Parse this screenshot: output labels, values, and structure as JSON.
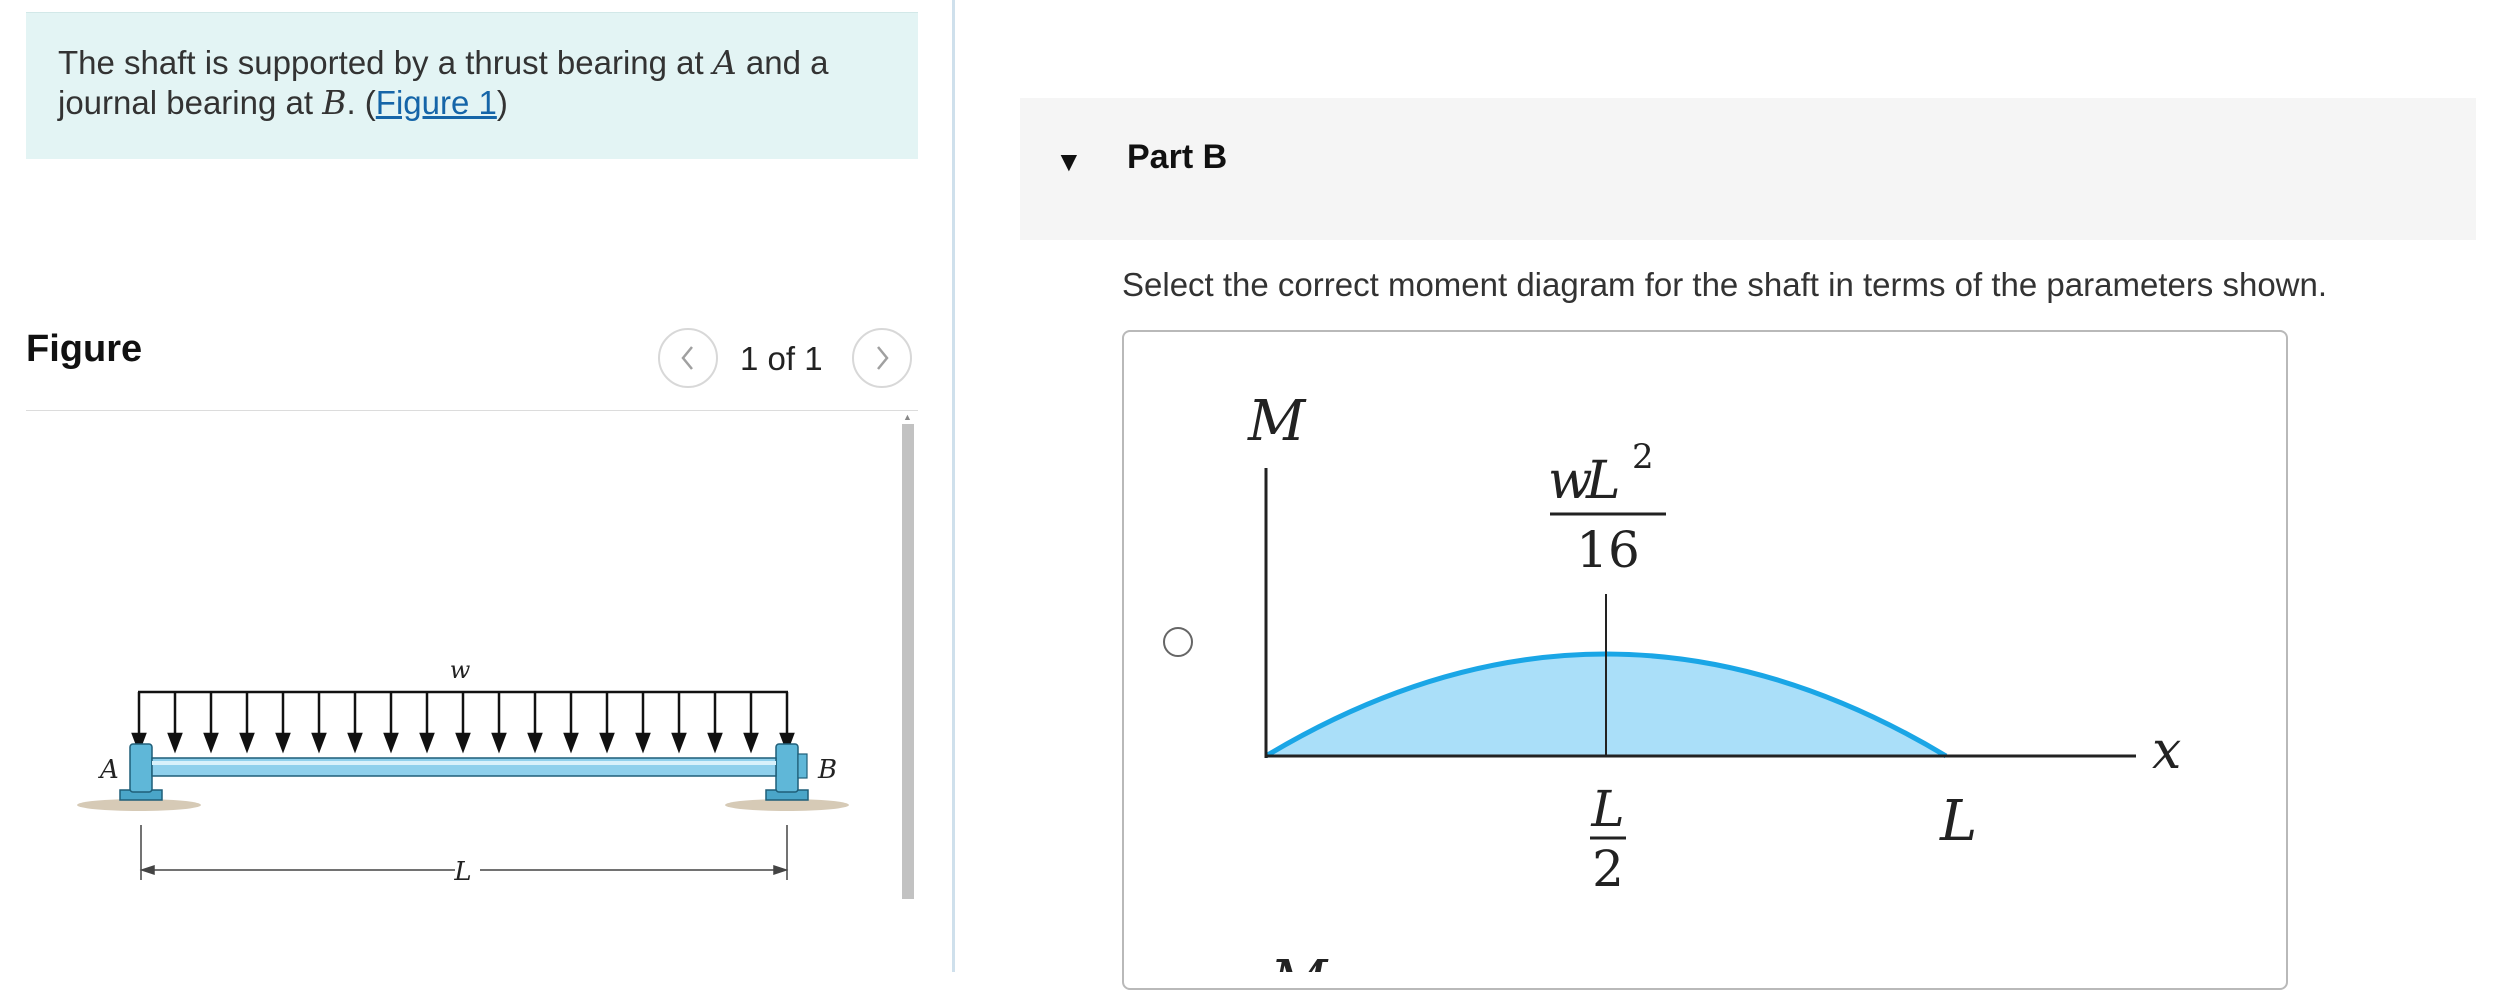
{
  "problem": {
    "text_part1": "The shaft is supported by a thrust bearing at ",
    "var_a": "A",
    "text_part2": " and a journal bearing at ",
    "var_b": "B",
    "text_part3": ". (",
    "figure_link": "Figure 1",
    "text_part4": ")"
  },
  "figure": {
    "heading": "Figure",
    "counter": "1 of 1",
    "prev_icon": "chevron-left-icon",
    "next_icon": "chevron-right-icon",
    "labels": {
      "load": "w",
      "support_a": "A",
      "support_b": "B",
      "length": "L"
    }
  },
  "part": {
    "caret_icon": "caret-down-icon",
    "title": "Part B",
    "instructions": "Select the correct moment diagram for the shaft in terms of the parameters shown."
  },
  "option_a": {
    "y_axis_label": "M",
    "x_axis_label": "x",
    "peak_numerator_w": "w",
    "peak_numerator_L": "L",
    "peak_exponent": "2",
    "peak_denominator": "16",
    "mid_label_num": "L",
    "mid_label_den": "2",
    "end_label": "L"
  },
  "colors": {
    "accent_fill": "#aadff9",
    "accent_stroke": "#1aa6e6",
    "problem_bg": "#e3f4f4",
    "link": "#1565a8"
  }
}
